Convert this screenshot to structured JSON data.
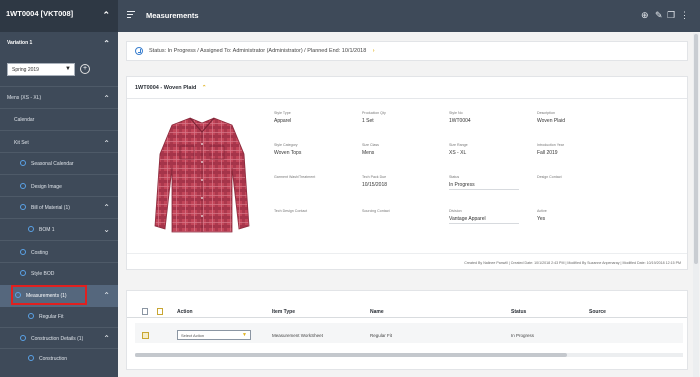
{
  "sidebar": {
    "header": "1WT0004 [VKT008]",
    "section_title": "Variation 1",
    "season": "Spring 2019",
    "items": [
      {
        "label": "Mens (XS - XL)"
      },
      {
        "label": "Calendar"
      },
      {
        "label": "Kit Set"
      },
      {
        "label": "Seasonal Calendar"
      },
      {
        "label": "Design Image"
      },
      {
        "label": "Bill of Material (1)"
      },
      {
        "label": "BOM 1"
      },
      {
        "label": "Costing"
      },
      {
        "label": "Style BOD"
      },
      {
        "label": "Measurements (1)"
      },
      {
        "label": "Regular Fit"
      },
      {
        "label": "Construction Details (1)"
      },
      {
        "label": "Construction"
      }
    ]
  },
  "topbar": {
    "title": "Measurements",
    "icons": [
      "add-icon",
      "edit-icon",
      "copy-icon",
      "more-icon"
    ]
  },
  "status": {
    "text": "Status: In Progress / Assigned To: Administrator (Administrator) / Planned End: 10/1/2018"
  },
  "style_card": {
    "title": "1WT0004 - Woven Plaid",
    "product_image": "plaid-shirt",
    "attributes": [
      {
        "label": "Style Type",
        "value": "Apparel"
      },
      {
        "label": "Production Qty",
        "value": "1 Set"
      },
      {
        "label": "Style No",
        "value": "1WT0004"
      },
      {
        "label": "Description",
        "value": "Woven Plaid"
      },
      {
        "label": "Style Category",
        "value": "Woven Tops"
      },
      {
        "label": "Size Class",
        "value": "Mens"
      },
      {
        "label": "Size Range",
        "value": "XS - XL"
      },
      {
        "label": "Introduction Year",
        "value": "Fall 2019"
      },
      {
        "label": "Garment Wash/Treatment",
        "value": ""
      },
      {
        "label": "Tech Pack Due",
        "value": "10/15/2018"
      },
      {
        "label": "Status",
        "value": "In Progress"
      },
      {
        "label": "Design Contact",
        "value": ""
      },
      {
        "label": "Tech Design Contact",
        "value": ""
      },
      {
        "label": "Sourcing Contact",
        "value": ""
      },
      {
        "label": "Division",
        "value": "Vantage Apparel"
      },
      {
        "label": "Active",
        "value": "Yes"
      }
    ],
    "audit": "Created By Nalinee Panwill | Created Date: 10/1/2018 2:43 PM | Modified By Suzanne Anpenaray | Modified Date: 10/19/2018 12:15 PM"
  },
  "grid": {
    "columns": [
      "Action",
      "Item Type",
      "Name",
      "Status",
      "Source"
    ],
    "rows": [
      {
        "action": "Select Action",
        "item_type": "Measurement WorkSheet",
        "name": "Regular Fit",
        "status": "In Progress",
        "source": ""
      }
    ]
  },
  "colors": {
    "sidebar_bg": "#3e4a59",
    "accent_blue": "#3a7fcf",
    "accent_yellow": "#e0b21e",
    "highlight_red": "#e0201f",
    "shirt_red": "#c24559"
  }
}
